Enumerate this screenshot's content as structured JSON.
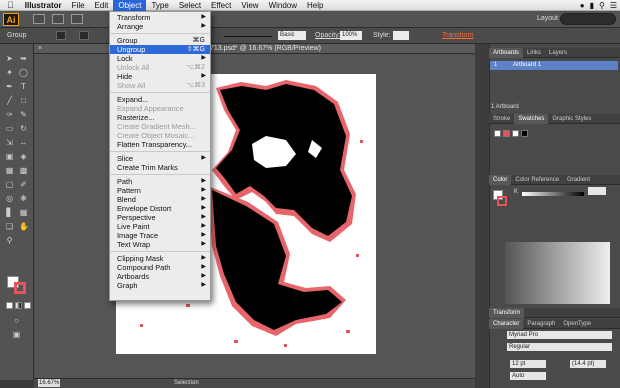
{
  "menubar": {
    "apple": "",
    "app_name": "Illustrator",
    "items": [
      "File",
      "Edit",
      "Object",
      "Type",
      "Select",
      "Effect",
      "View",
      "Window",
      "Help"
    ],
    "active_item": "Object"
  },
  "appbar": {
    "logo": "Ai",
    "layout_label": "Layout"
  },
  "controlbar": {
    "group_label": "Group",
    "brush_preset": "Basic",
    "opacity_label": "Opacity:",
    "opacity_value": "100%",
    "style_label": "Style:",
    "transform_label": "Transform"
  },
  "document": {
    "tab_title": "713.psd* @ 16.67% (RGB/Preview)"
  },
  "statusbar": {
    "zoom": "16.67%",
    "selection_tool": "Selection"
  },
  "object_menu": {
    "items": [
      {
        "label": "Transform",
        "submenu": true
      },
      {
        "label": "Arrange",
        "submenu": true
      },
      {
        "sep": true
      },
      {
        "label": "Group",
        "shortcut": "⌘G"
      },
      {
        "label": "Ungroup",
        "shortcut": "⇧⌘G",
        "highlighted": true
      },
      {
        "label": "Lock",
        "submenu": true
      },
      {
        "label": "Unlock All",
        "shortcut": "⌥⌘2",
        "disabled": true
      },
      {
        "label": "Hide",
        "submenu": true
      },
      {
        "label": "Show All",
        "shortcut": "⌥⌘3",
        "disabled": true
      },
      {
        "sep": true
      },
      {
        "label": "Expand..."
      },
      {
        "label": "Expand Appearance",
        "disabled": true
      },
      {
        "label": "Rasterize..."
      },
      {
        "label": "Create Gradient Mesh...",
        "disabled": true
      },
      {
        "label": "Create Object Mosaic...",
        "disabled": true
      },
      {
        "label": "Flatten Transparency..."
      },
      {
        "sep": true
      },
      {
        "label": "Slice",
        "submenu": true
      },
      {
        "label": "Create Trim Marks"
      },
      {
        "sep": true
      },
      {
        "label": "Path",
        "submenu": true
      },
      {
        "label": "Pattern",
        "submenu": true
      },
      {
        "label": "Blend",
        "submenu": true
      },
      {
        "label": "Envelope Distort",
        "submenu": true
      },
      {
        "label": "Perspective",
        "submenu": true
      },
      {
        "label": "Live Paint",
        "submenu": true
      },
      {
        "label": "Image Trace",
        "submenu": true
      },
      {
        "label": "Text Wrap",
        "submenu": true
      },
      {
        "sep": true
      },
      {
        "label": "Clipping Mask",
        "submenu": true
      },
      {
        "label": "Compound Path",
        "submenu": true
      },
      {
        "label": "Artboards",
        "submenu": true
      },
      {
        "label": "Graph",
        "submenu": true
      }
    ]
  },
  "panels": {
    "artboards_tabs": [
      "Artboards",
      "Links",
      "Layers"
    ],
    "artboard_row": {
      "index": "1",
      "name": "Artboard 1"
    },
    "artboard_count": "1 Artboard",
    "swatches_tabs": [
      "Stroke",
      "Swatches",
      "Graphic Styles"
    ],
    "color_tabs": [
      "Color",
      "Color Reference",
      "Gradient"
    ],
    "color_channel": "K",
    "transform_tab": "Transform",
    "char_tabs": [
      "Character",
      "Paragraph",
      "OpenType"
    ],
    "font_family": "Myriad Pro",
    "font_style": "Regular",
    "font_size": "12 pt",
    "leading": "(14.4 pt)",
    "kerning": "Auto"
  },
  "colors": {
    "menu_highlight": "#2f6ad9",
    "ai_orange": "#f6a01a",
    "trace_red": "#e5545c",
    "transform_link": "#ff6a3a"
  }
}
